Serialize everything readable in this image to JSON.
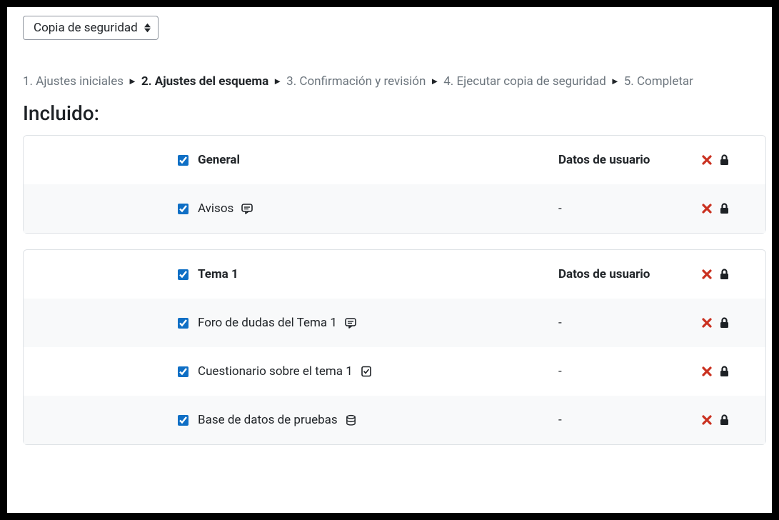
{
  "dropdown_label": "Copia de seguridad",
  "steps": [
    "1. Ajustes iniciales",
    "2. Ajustes del esquema",
    "3. Confirmación y revisión",
    "4. Ejecutar copia de seguridad",
    "5. Completar"
  ],
  "current_step_index": 1,
  "section_title": "Incluido:",
  "user_data_label": "Datos de usuario",
  "dash": "-",
  "blocks": [
    {
      "header": "General",
      "items": [
        {
          "label": "Avisos",
          "icon": "forum"
        }
      ]
    },
    {
      "header": "Tema 1",
      "items": [
        {
          "label": "Foro de dudas del Tema 1",
          "icon": "forum"
        },
        {
          "label": "Cuestionario sobre el tema 1",
          "icon": "quiz"
        },
        {
          "label": "Base de datos de pruebas",
          "icon": "database"
        }
      ]
    }
  ]
}
